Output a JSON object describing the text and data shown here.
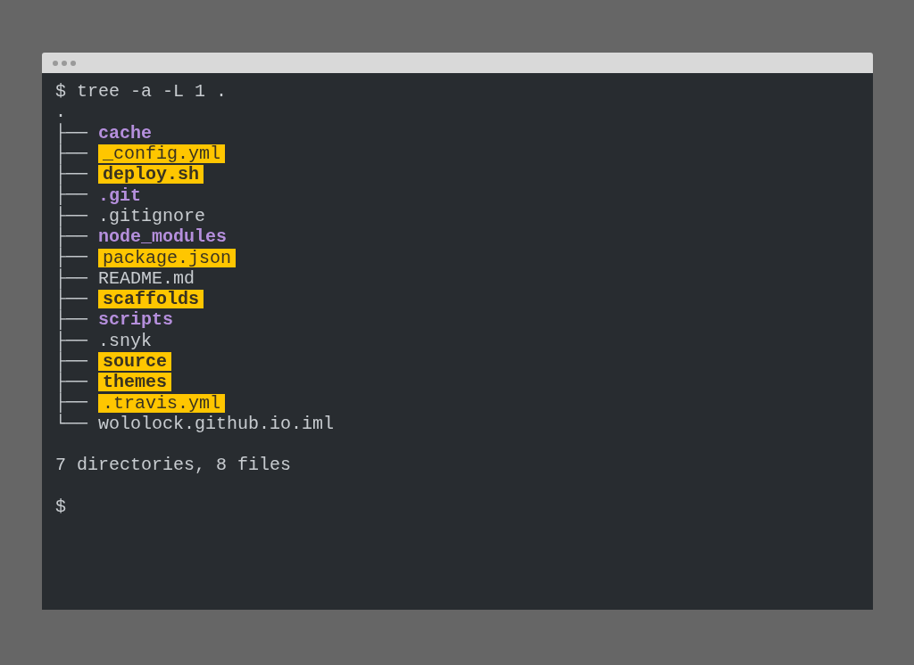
{
  "command": {
    "prompt": "$",
    "text": "tree -a -L 1 ."
  },
  "root": ".",
  "entries": [
    {
      "branch": "├──",
      "name": "cache",
      "kind": "dir"
    },
    {
      "branch": "├──",
      "name": "_config.yml",
      "kind": "highlight-file"
    },
    {
      "branch": "├──",
      "name": "deploy.sh",
      "kind": "highlight-dir"
    },
    {
      "branch": "├──",
      "name": ".git",
      "kind": "dir"
    },
    {
      "branch": "├──",
      "name": ".gitignore",
      "kind": "file"
    },
    {
      "branch": "├──",
      "name": "node_modules",
      "kind": "dir"
    },
    {
      "branch": "├──",
      "name": "package.json",
      "kind": "highlight-file"
    },
    {
      "branch": "├──",
      "name": "README.md",
      "kind": "file"
    },
    {
      "branch": "├──",
      "name": "scaffolds",
      "kind": "highlight-dir"
    },
    {
      "branch": "├──",
      "name": "scripts",
      "kind": "dir"
    },
    {
      "branch": "├──",
      "name": ".snyk",
      "kind": "file"
    },
    {
      "branch": "├──",
      "name": "source",
      "kind": "highlight-dir"
    },
    {
      "branch": "├──",
      "name": "themes",
      "kind": "highlight-dir"
    },
    {
      "branch": "├──",
      "name": ".travis.yml",
      "kind": "highlight-file"
    },
    {
      "branch": "└──",
      "name": "wololock.github.io.iml",
      "kind": "file"
    }
  ],
  "summary": "7 directories, 8 files",
  "prompt": "$"
}
